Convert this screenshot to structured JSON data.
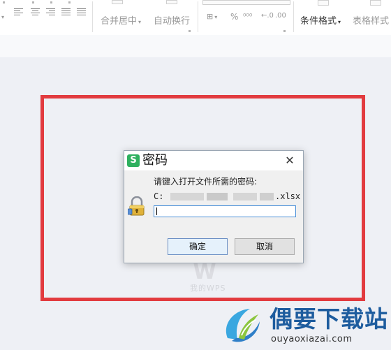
{
  "ribbon": {
    "merge_center_label": "合并居中",
    "wrap_text_label": "自动换行",
    "percent_label": "%",
    "conditional_format_label": "条件格式",
    "table_style_label": "表格样式"
  },
  "dialog": {
    "title": "密码",
    "app_icon_letter": "S",
    "close_glyph": "✕",
    "prompt": "请键入打开文件所需的密码:",
    "path_prefix": "C:",
    "path_suffix": ".xlsx",
    "password_value": "",
    "ok_label": "确定",
    "cancel_label": "取消"
  },
  "watermark": {
    "logo_letter": "W",
    "text": "我的WPS"
  },
  "brand": {
    "name": "偶要下载站",
    "url": "ouyaoxiazai.com"
  },
  "colors": {
    "highlight": "#e23b3f",
    "app_green": "#2eb05f",
    "brand_blue": "#1d5c9e",
    "focus_blue": "#4a90d9"
  },
  "icons": [
    "align-left-icon",
    "align-center-icon",
    "align-right-icon",
    "justify-icon",
    "distribute-icon",
    "merge-center-icon",
    "wrap-text-icon",
    "percent-icon",
    "decimal-icon",
    "conditional-format-icon",
    "table-style-icon",
    "lock-key-icon",
    "close-icon"
  ]
}
